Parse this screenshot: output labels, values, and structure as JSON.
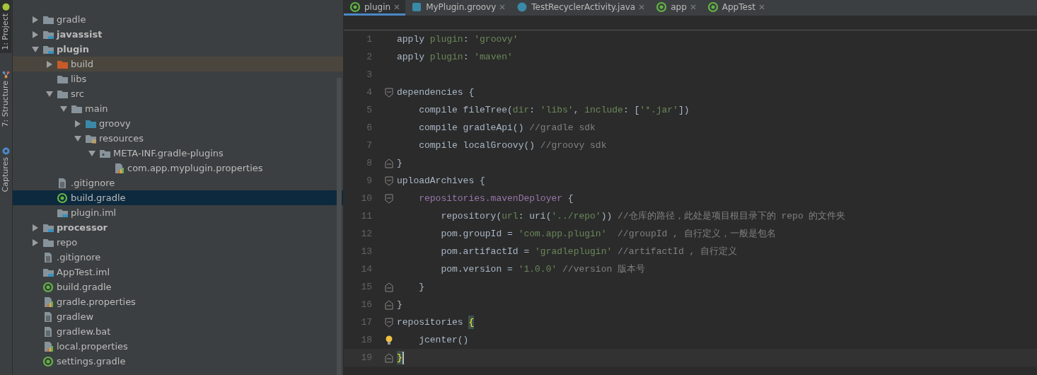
{
  "tool_strip": [
    {
      "label": "1: Project",
      "kind": "android",
      "selected": true
    },
    {
      "label": "7: Structure",
      "kind": "structure",
      "selected": false
    },
    {
      "label": "Captures",
      "kind": "captures",
      "selected": false
    }
  ],
  "project_tree": [
    {
      "name": "gradle",
      "kind": "folder",
      "expanded": false
    },
    {
      "name": "javassist",
      "kind": "module",
      "bold": true,
      "expanded": false
    },
    {
      "name": "plugin",
      "kind": "module",
      "bold": true,
      "expanded": true,
      "children": [
        {
          "name": "build",
          "kind": "excluded",
          "expanded": false,
          "hovered": true
        },
        {
          "name": "libs",
          "kind": "folder"
        },
        {
          "name": "src",
          "kind": "folder",
          "expanded": true,
          "children": [
            {
              "name": "main",
              "kind": "folder",
              "expanded": true,
              "children": [
                {
                  "name": "groovy",
                  "kind": "source",
                  "expanded": false
                },
                {
                  "name": "resources",
                  "kind": "resources",
                  "expanded": true,
                  "children": [
                    {
                      "name": "META-INF.gradle-plugins",
                      "kind": "package",
                      "expanded": true,
                      "children": [
                        {
                          "name": "com.app.myplugin.properties",
                          "kind": "properties"
                        }
                      ]
                    }
                  ]
                }
              ]
            }
          ]
        },
        {
          "name": ".gitignore",
          "kind": "text"
        },
        {
          "name": "build.gradle",
          "kind": "gradle",
          "selected": true
        },
        {
          "name": "plugin.iml",
          "kind": "module"
        }
      ]
    },
    {
      "name": "processor",
      "kind": "module",
      "bold": true,
      "expanded": false
    },
    {
      "name": "repo",
      "kind": "folder",
      "expanded": false
    },
    {
      "name": ".gitignore",
      "kind": "text"
    },
    {
      "name": "AppTest.iml",
      "kind": "module"
    },
    {
      "name": "build.gradle",
      "kind": "gradle"
    },
    {
      "name": "gradle.properties",
      "kind": "properties"
    },
    {
      "name": "gradlew",
      "kind": "text"
    },
    {
      "name": "gradlew.bat",
      "kind": "text"
    },
    {
      "name": "local.properties",
      "kind": "properties"
    },
    {
      "name": "settings.gradle",
      "kind": "gradle"
    }
  ],
  "tabs": [
    {
      "label": "plugin",
      "kind": "gradle",
      "selected": true
    },
    {
      "label": "MyPlugin.groovy",
      "kind": "groovy",
      "selected": false
    },
    {
      "label": "TestRecyclerActivity.java",
      "kind": "class",
      "selected": false
    },
    {
      "label": "app",
      "kind": "gradle",
      "selected": false
    },
    {
      "label": "AppTest",
      "kind": "gradle",
      "selected": false
    }
  ],
  "code_lines": [
    {
      "number": "1",
      "kind": "plain",
      "tokens": [
        {
          "kind": "plain",
          "text": "apply "
        },
        {
          "kind": "arg",
          "text": "plugin"
        },
        {
          "kind": "plain",
          "text": ": "
        },
        {
          "kind": "string",
          "text": "'groovy'"
        }
      ]
    },
    {
      "number": "2",
      "kind": "plain",
      "tokens": [
        {
          "kind": "plain",
          "text": "apply "
        },
        {
          "kind": "arg",
          "text": "plugin"
        },
        {
          "kind": "plain",
          "text": ": "
        },
        {
          "kind": "string",
          "text": "'maven'"
        }
      ]
    },
    {
      "number": "3",
      "kind": "plain"
    },
    {
      "number": "4",
      "kind": "fold_start",
      "tokens": [
        {
          "kind": "plain",
          "text": "dependencies {"
        }
      ]
    },
    {
      "number": "5",
      "kind": "plain",
      "tokens": [
        {
          "kind": "plain",
          "text": "    compile fileTree("
        },
        {
          "kind": "arg",
          "text": "dir"
        },
        {
          "kind": "plain",
          "text": ": "
        },
        {
          "kind": "string",
          "text": "'libs'"
        },
        {
          "kind": "plain",
          "text": ", "
        },
        {
          "kind": "arg",
          "text": "include"
        },
        {
          "kind": "plain",
          "text": ": ["
        },
        {
          "kind": "string",
          "text": "'*.jar'"
        },
        {
          "kind": "plain",
          "text": "])"
        }
      ]
    },
    {
      "number": "6",
      "kind": "plain",
      "tokens": [
        {
          "kind": "plain",
          "text": "    compile gradleApi() "
        },
        {
          "kind": "comment",
          "text": "//gradle sdk"
        }
      ]
    },
    {
      "number": "7",
      "kind": "plain",
      "tokens": [
        {
          "kind": "plain",
          "text": "    compile localGroovy() "
        },
        {
          "kind": "comment",
          "text": "//groovy sdk"
        }
      ]
    },
    {
      "number": "8",
      "kind": "fold_end",
      "tokens": [
        {
          "kind": "plain",
          "text": "}"
        }
      ]
    },
    {
      "number": "9",
      "kind": "fold_start",
      "tokens": [
        {
          "kind": "plain",
          "text": "uploadArchives {"
        }
      ]
    },
    {
      "number": "10",
      "kind": "fold_start",
      "tokens": [
        {
          "kind": "field",
          "text": "    repositories.mavenDeployer"
        },
        {
          "kind": "plain",
          "text": " {"
        }
      ]
    },
    {
      "number": "11",
      "kind": "plain",
      "tokens": [
        {
          "kind": "plain",
          "text": "        repository("
        },
        {
          "kind": "arg",
          "text": "url"
        },
        {
          "kind": "plain",
          "text": ": uri("
        },
        {
          "kind": "string",
          "text": "'../repo'"
        },
        {
          "kind": "plain",
          "text": ")) "
        },
        {
          "kind": "comment",
          "text": "//仓库的路径，此处是项目根目录下的 repo 的文件夹"
        }
      ]
    },
    {
      "number": "12",
      "kind": "plain",
      "tokens": [
        {
          "kind": "plain",
          "text": "        pom.groupId = "
        },
        {
          "kind": "string",
          "text": "'com.app.plugin'"
        },
        {
          "kind": "comment",
          "text": "  //groupId , 自行定义，一般是包名"
        }
      ]
    },
    {
      "number": "13",
      "kind": "plain",
      "tokens": [
        {
          "kind": "plain",
          "text": "        pom.artifactId = "
        },
        {
          "kind": "string",
          "text": "'gradleplugin'"
        },
        {
          "kind": "comment",
          "text": " //artifactId , 自行定义"
        }
      ]
    },
    {
      "number": "14",
      "kind": "plain",
      "tokens": [
        {
          "kind": "plain",
          "text": "        pom.version = "
        },
        {
          "kind": "string",
          "text": "'1.0.0'"
        },
        {
          "kind": "comment",
          "text": " //version 版本号"
        }
      ]
    },
    {
      "number": "15",
      "kind": "fold_end",
      "tokens": [
        {
          "kind": "plain",
          "text": "    }"
        }
      ]
    },
    {
      "number": "16",
      "kind": "fold_end",
      "tokens": [
        {
          "kind": "plain",
          "text": "}"
        }
      ]
    },
    {
      "number": "17",
      "kind": "fold_start",
      "tokens": [
        {
          "kind": "plain",
          "text": "repositories "
        },
        {
          "kind": "brace",
          "text": "{"
        }
      ]
    },
    {
      "number": "18",
      "kind": "plain",
      "bulb": true,
      "tokens": [
        {
          "kind": "plain",
          "text": "    jcenter()"
        }
      ]
    },
    {
      "number": "19",
      "kind": "fold_end",
      "current": true,
      "tokens": [
        {
          "kind": "brace",
          "text": "}"
        }
      ]
    }
  ]
}
